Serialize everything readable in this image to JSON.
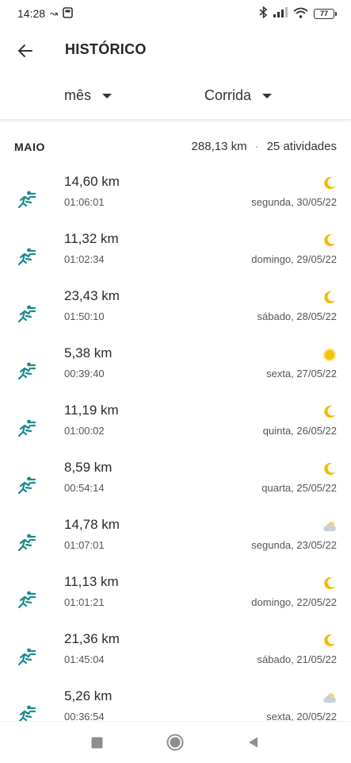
{
  "status_bar": {
    "time": "14:28",
    "battery": "77"
  },
  "header": {
    "title": "HISTÓRICO",
    "period_select": "mês",
    "type_select": "Corrida"
  },
  "month": {
    "label": "MAIO",
    "distance": "288,13 km",
    "separator": "·",
    "count": "25 atividades"
  },
  "activities": [
    {
      "distance": "14,60 km",
      "duration": "01:06:01",
      "date": "segunda, 30/05/22",
      "weather_icon": "moon-icon"
    },
    {
      "distance": "11,32 km",
      "duration": "01:02:34",
      "date": "domingo, 29/05/22",
      "weather_icon": "moon-icon"
    },
    {
      "distance": "23,43 km",
      "duration": "01:50:10",
      "date": "sábado, 28/05/22",
      "weather_icon": "moon-icon"
    },
    {
      "distance": "5,38 km",
      "duration": "00:39:40",
      "date": "sexta, 27/05/22",
      "weather_icon": "sun-icon"
    },
    {
      "distance": "11,19 km",
      "duration": "01:00:02",
      "date": "quinta, 26/05/22",
      "weather_icon": "moon-icon"
    },
    {
      "distance": "8,59 km",
      "duration": "00:54:14",
      "date": "quarta, 25/05/22",
      "weather_icon": "moon-icon"
    },
    {
      "distance": "14,78 km",
      "duration": "01:07:01",
      "date": "segunda, 23/05/22",
      "weather_icon": "cloudy-icon"
    },
    {
      "distance": "11,13 km",
      "duration": "01:01:21",
      "date": "domingo, 22/05/22",
      "weather_icon": "moon-icon"
    },
    {
      "distance": "21,36 km",
      "duration": "01:45:04",
      "date": "sábado, 21/05/22",
      "weather_icon": "moon-icon"
    },
    {
      "distance": "5,26 km",
      "duration": "00:36:54",
      "date": "sexta, 20/05/22",
      "weather_icon": "cloudy-icon"
    }
  ],
  "colors": {
    "accent": "#1a8a8a",
    "moon": "#f5b800",
    "sun": "#f5c400",
    "cloud": "#b8c8d8"
  }
}
